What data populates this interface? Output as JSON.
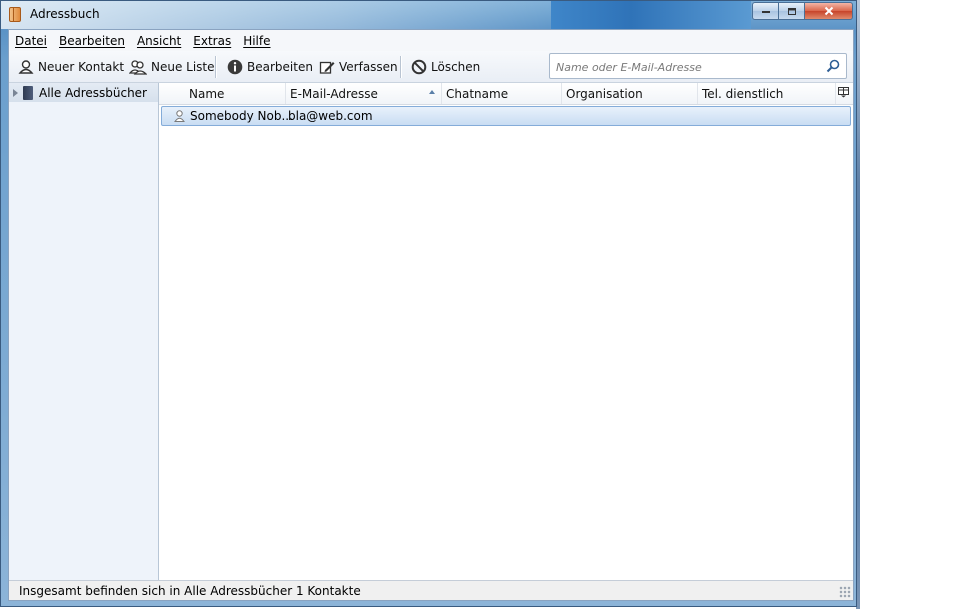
{
  "window": {
    "title": "Adressbuch"
  },
  "menu": [
    "Datei",
    "Bearbeiten",
    "Ansicht",
    "Extras",
    "Hilfe"
  ],
  "toolbar": {
    "new_contact": "Neuer Kontakt",
    "new_list": "Neue Liste",
    "edit": "Bearbeiten",
    "compose": "Verfassen",
    "delete": "Löschen"
  },
  "search": {
    "placeholder": "Name oder E-Mail-Adresse",
    "value": ""
  },
  "sidebar": {
    "items": [
      {
        "label": "Alle Adressbücher"
      }
    ]
  },
  "table": {
    "columns": [
      "Name",
      "E-Mail-Adresse",
      "Chatname",
      "Organisation",
      "Tel. dienstlich"
    ],
    "sorted_column": "E-Mail-Adresse",
    "rows": [
      {
        "name": "Somebody Nob...",
        "email": "bla@web.com",
        "chat": "",
        "org": "",
        "phone": ""
      }
    ]
  },
  "status": {
    "text": "Insgesamt befinden sich in Alle Adressbücher 1 Kontakte"
  }
}
